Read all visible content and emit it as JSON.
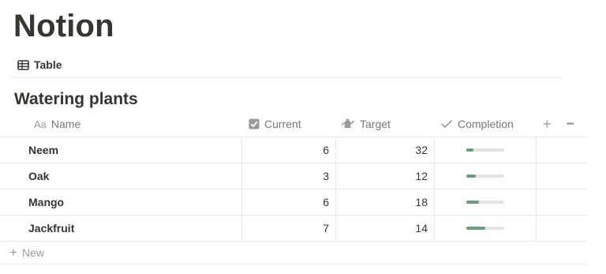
{
  "page": {
    "title": "Notion"
  },
  "view_tab": {
    "label": "Table",
    "icon": "table-icon"
  },
  "database": {
    "title": "Watering plants",
    "columns": [
      {
        "label": "Name",
        "icon": "text-property-icon"
      },
      {
        "label": "Current",
        "icon": "checkbox-icon"
      },
      {
        "label": "Target",
        "icon": "watering-can-icon"
      },
      {
        "label": "Completion",
        "icon": "check-icon"
      }
    ],
    "add_column_icon": "+",
    "more_icon": "•••",
    "rows": [
      {
        "name": "Neem",
        "current": "6",
        "target": "32",
        "completion": 0.1875
      },
      {
        "name": "Oak",
        "current": "3",
        "target": "12",
        "completion": 0.25
      },
      {
        "name": "Mango",
        "current": "6",
        "target": "18",
        "completion": 0.3333
      },
      {
        "name": "Jackfruit",
        "current": "7",
        "target": "14",
        "completion": 0.5
      }
    ],
    "new_label": "New"
  },
  "colors": {
    "text": "#37352f",
    "muted": "#787774",
    "divider": "#e9e9e7",
    "progress_fill": "#6c9b7d",
    "progress_track": "#e3e2e0"
  }
}
